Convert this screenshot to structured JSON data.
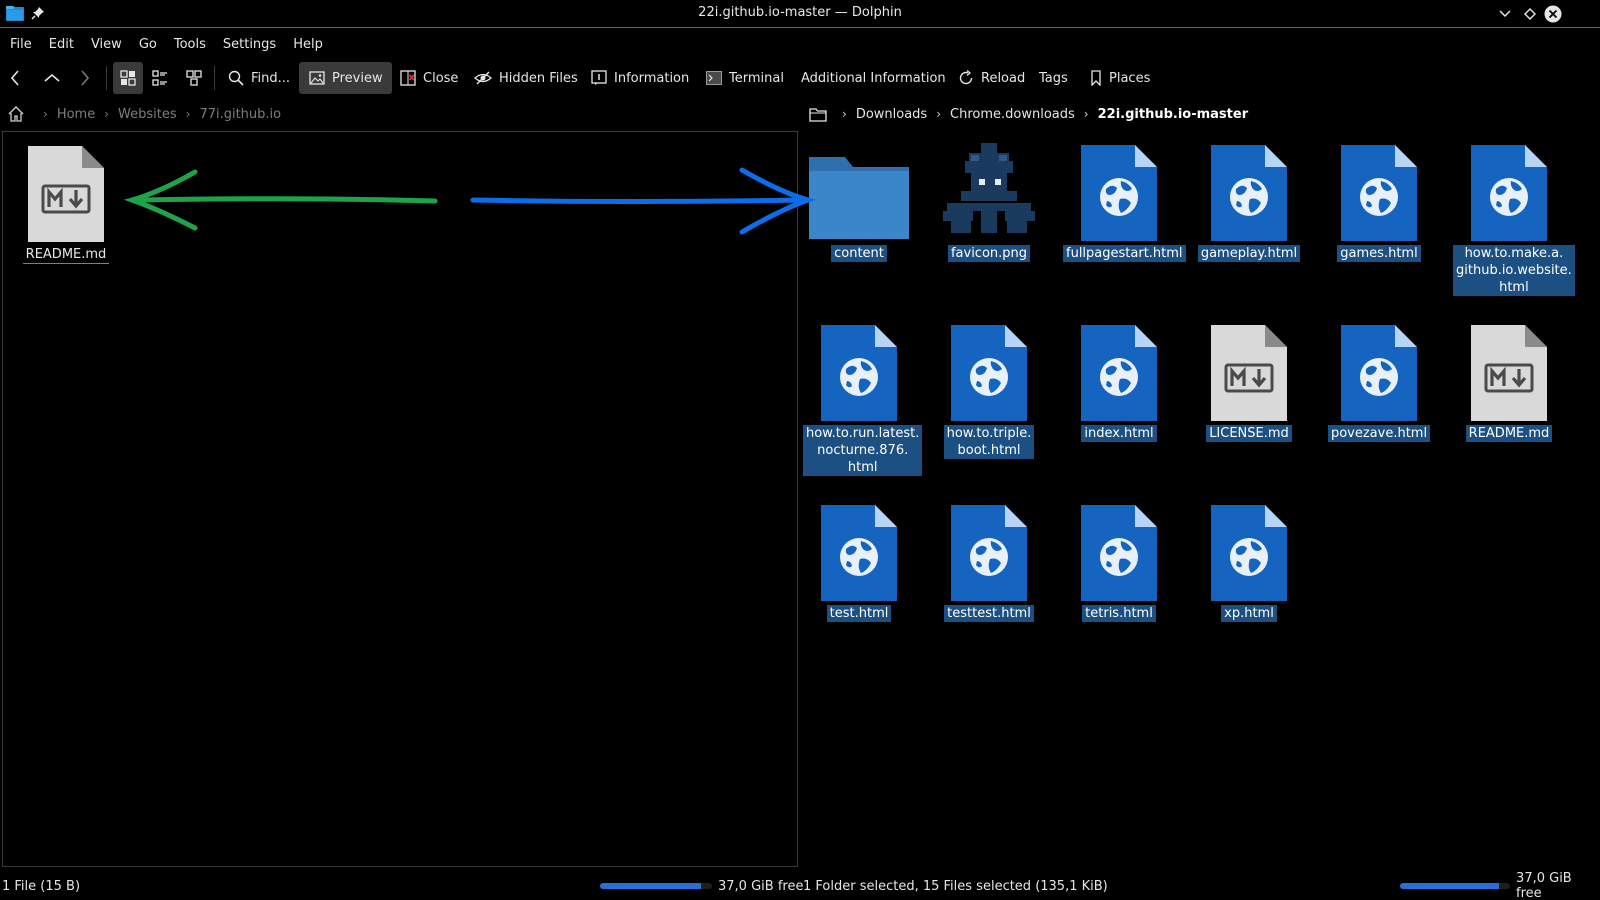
{
  "window": {
    "title": "22i.github.io-master — Dolphin"
  },
  "menubar": [
    "File",
    "Edit",
    "View",
    "Go",
    "Tools",
    "Settings",
    "Help"
  ],
  "toolbar": {
    "find": "Find...",
    "preview": "Preview",
    "close": "Close",
    "hidden_files": "Hidden Files",
    "information": "Information",
    "terminal": "Terminal",
    "additional_information": "Additional Information",
    "reload": "Reload",
    "tags": "Tags",
    "places": "Places"
  },
  "left_pane": {
    "breadcrumb": [
      "Home",
      "Websites",
      "77i.github.io"
    ],
    "items": [
      {
        "name": "README.md",
        "icon": "markdown-file-icon"
      }
    ],
    "status": "1 File (15 B)",
    "free_space": "37,0 GiB free",
    "free_fraction": 0.9
  },
  "right_pane": {
    "breadcrumb": [
      "Downloads",
      "Chrome.downloads",
      "22i.github.io-master"
    ],
    "items": [
      {
        "name": "content",
        "icon": "folder-icon"
      },
      {
        "name": "favicon.png",
        "icon": "image-thumbnail"
      },
      {
        "name": "fullpagestart.html",
        "icon": "html-file-icon"
      },
      {
        "name": "gameplay.html",
        "icon": "html-file-icon"
      },
      {
        "name": "games.html",
        "icon": "html-file-icon"
      },
      {
        "name": "how.to.make.a.\ngithub.io.website.\nhtml",
        "icon": "html-file-icon"
      },
      {
        "name": "how.to.run.latest.\nnocturne.876.\nhtml",
        "icon": "html-file-icon"
      },
      {
        "name": "how.to.triple.\nboot.html",
        "icon": "html-file-icon"
      },
      {
        "name": "index.html",
        "icon": "html-file-icon"
      },
      {
        "name": "LICENSE.md",
        "icon": "markdown-file-icon"
      },
      {
        "name": "povezave.html",
        "icon": "html-file-icon"
      },
      {
        "name": "README.md",
        "icon": "markdown-file-icon"
      },
      {
        "name": "test.html",
        "icon": "html-file-icon"
      },
      {
        "name": "testtest.html",
        "icon": "html-file-icon"
      },
      {
        "name": "tetris.html",
        "icon": "html-file-icon"
      },
      {
        "name": "xp.html",
        "icon": "html-file-icon"
      }
    ],
    "status": "1 Folder selected, 15 Files selected (135,1 KiB)",
    "free_space": "37,0 GiB free",
    "free_fraction": 0.9
  },
  "colors": {
    "selection": "#1c4f82",
    "accent": "#2b6ea6",
    "green_arrow": "#1fa34a",
    "blue_arrow": "#0b6ee8"
  }
}
